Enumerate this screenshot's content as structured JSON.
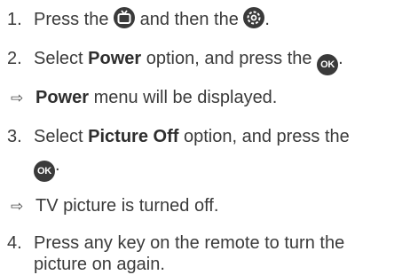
{
  "steps": [
    {
      "num": "1.",
      "pre": "Press the ",
      "mid": " and then the ",
      "post": "."
    },
    {
      "num": "2.",
      "pre": "Select ",
      "bold": "Power",
      "post": " option, and press the ",
      "end": "."
    },
    {
      "arrow": "⇨",
      "bold": "Power",
      "text": " menu will be displayed."
    },
    {
      "num": "3.",
      "pre": "Select ",
      "bold": "Picture Off",
      "post": " option, and press the"
    },
    {
      "end": "."
    },
    {
      "arrow": "⇨",
      "text": "TV picture is turned off."
    },
    {
      "num": "4.",
      "text": "Press any key on the remote to turn the"
    },
    {
      "text": "picture on again."
    }
  ],
  "icons": {
    "tv": "tv-icon",
    "settings": "gear-icon",
    "ok": "OK"
  }
}
